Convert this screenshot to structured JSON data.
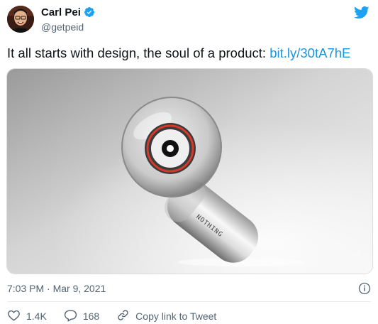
{
  "author": {
    "display_name": "Carl Pei",
    "handle": "@getpeid",
    "verified": true,
    "avatar_icon": "person-photo",
    "badge_icon": "verified-badge-icon"
  },
  "brand": {
    "logo_icon": "twitter-bird-icon",
    "accent_color": "#1da1f2",
    "link_color": "#1b95e0"
  },
  "tweet": {
    "text": "It all starts with design, the soul of a product: ",
    "link_text": "bit.ly/30tA7hE"
  },
  "media": {
    "description_icon": "earbud-photo",
    "engraving": "NOTHING"
  },
  "meta": {
    "timestamp": "7:03 PM · Mar 9, 2021",
    "info_icon": "info-icon"
  },
  "actions": {
    "likes_count": "1.4K",
    "replies_count": "168",
    "copy_link_label": "Copy link to Tweet"
  }
}
